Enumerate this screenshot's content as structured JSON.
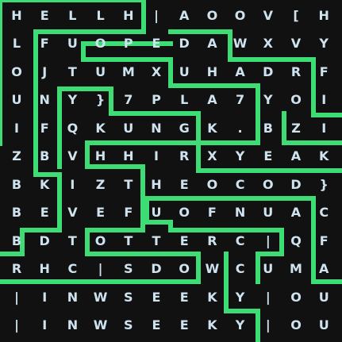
{
  "colors": {
    "background": "#111111",
    "letter": "#cfe3ef",
    "path": "#3ddc74"
  },
  "grid": {
    "rows": [
      [
        "H",
        "E",
        "L",
        "L",
        "H",
        "|",
        "A",
        "O",
        "O",
        "V",
        "[",
        "H"
      ],
      [
        "L",
        "F",
        "U",
        "O",
        "P",
        "E",
        "D",
        "A",
        "W",
        "X",
        "V",
        "Y"
      ],
      [
        "O",
        "J",
        "T",
        "U",
        "M",
        "X",
        "U",
        "H",
        "A",
        "D",
        "R",
        "F"
      ],
      [
        "U",
        "N",
        "Y",
        "}",
        "7",
        "P",
        "L",
        "A",
        "7",
        "Y",
        "O",
        "I"
      ],
      [
        "I",
        "F",
        "Q",
        "K",
        "U",
        "N",
        "G",
        "K",
        ".",
        "B",
        "Z",
        "I"
      ],
      [
        "Z",
        "B",
        "V",
        "H",
        "H",
        "I",
        "R",
        "X",
        "Y",
        "E",
        "A",
        "K"
      ],
      [
        "B",
        "K",
        "I",
        "Z",
        "T",
        "H",
        "E",
        "O",
        "C",
        "O",
        "D",
        "}"
      ],
      [
        "B",
        "E",
        "V",
        "E",
        "F",
        "U",
        "O",
        "F",
        "N",
        "U",
        "A",
        "C"
      ],
      [
        "B",
        "D",
        "T",
        "O",
        "T",
        "T",
        "E",
        "R",
        "C",
        "|",
        "Q",
        "F"
      ],
      [
        "R",
        "H",
        "C",
        "|",
        "S",
        "D",
        "O",
        "W",
        "C",
        "U",
        "M",
        "A"
      ],
      [
        "|",
        "I",
        "N",
        "W",
        "S",
        "E",
        "E",
        "K",
        "Y",
        "|",
        "O",
        "U"
      ],
      [
        "|",
        "I",
        "N",
        "W",
        "S",
        "E",
        "E",
        "K",
        "Y",
        "|",
        "O",
        "U"
      ]
    ]
  },
  "path": {
    "segments": [
      [
        [
          0,
          0
        ],
        [
          0,
          181
        ]
      ],
      [
        [
          0,
          181
        ],
        [
          -10,
          181
        ]
      ],
      [
        [
          0,
          0
        ],
        [
          181,
          0
        ]
      ],
      [
        [
          181,
          0
        ],
        [
          181,
          40
        ]
      ],
      [
        [
          181,
          40
        ],
        [
          45,
          40
        ]
      ],
      [
        [
          45,
          40
        ],
        [
          45,
          220
        ]
      ],
      [
        [
          45,
          220
        ],
        [
          75,
          220
        ]
      ],
      [
        [
          75,
          220
        ],
        [
          75,
          290
        ]
      ],
      [
        [
          75,
          290
        ],
        [
          28,
          290
        ]
      ],
      [
        [
          28,
          290
        ],
        [
          28,
          320
        ]
      ],
      [
        [
          28,
          320
        ],
        [
          -10,
          320
        ]
      ],
      [
        [
          105,
          55
        ],
        [
          105,
          75
        ]
      ],
      [
        [
          105,
          75
        ],
        [
          215,
          75
        ]
      ],
      [
        [
          215,
          75
        ],
        [
          215,
          108
        ]
      ],
      [
        [
          215,
          108
        ],
        [
          325,
          108
        ]
      ],
      [
        [
          325,
          108
        ],
        [
          325,
          180
        ]
      ],
      [
        [
          325,
          180
        ],
        [
          250,
          180
        ]
      ],
      [
        [
          250,
          180
        ],
        [
          250,
          143
        ]
      ],
      [
        [
          250,
          143
        ],
        [
          140,
          143
        ]
      ],
      [
        [
          140,
          143
        ],
        [
          140,
          112
        ]
      ],
      [
        [
          140,
          112
        ],
        [
          75,
          112
        ]
      ],
      [
        [
          75,
          112
        ],
        [
          75,
          180
        ]
      ],
      [
        [
          75,
          180
        ],
        [
          75,
          210
        ]
      ],
      [
        [
          105,
          55
        ],
        [
          215,
          55
        ]
      ],
      [
        [
          110,
          180
        ],
        [
          110,
          210
        ]
      ],
      [
        [
          110,
          180
        ],
        [
          250,
          180
        ]
      ],
      [
        [
          250,
          180
        ],
        [
          250,
          215
        ]
      ],
      [
        [
          250,
          215
        ],
        [
          431,
          215
        ]
      ],
      [
        [
          110,
          210
        ],
        [
          180,
          210
        ]
      ],
      [
        [
          180,
          210
        ],
        [
          180,
          290
        ]
      ],
      [
        [
          180,
          290
        ],
        [
          110,
          290
        ]
      ],
      [
        [
          110,
          290
        ],
        [
          110,
          320
        ]
      ],
      [
        [
          110,
          320
        ],
        [
          250,
          320
        ]
      ],
      [
        [
          250,
          320
        ],
        [
          250,
          355
        ]
      ],
      [
        [
          250,
          355
        ],
        [
          0,
          355
        ]
      ],
      [
        [
          215,
          40
        ],
        [
          290,
          40
        ]
      ],
      [
        [
          290,
          40
        ],
        [
          290,
          75
        ]
      ],
      [
        [
          290,
          75
        ],
        [
          395,
          75
        ]
      ],
      [
        [
          395,
          75
        ],
        [
          395,
          145
        ]
      ],
      [
        [
          395,
          145
        ],
        [
          431,
          145
        ]
      ],
      [
        [
          431,
          180
        ],
        [
          358,
          180
        ]
      ],
      [
        [
          358,
          180
        ],
        [
          358,
          143
        ]
      ],
      [
        [
          185,
          250
        ],
        [
          185,
          280
        ]
      ],
      [
        [
          185,
          250
        ],
        [
          395,
          250
        ]
      ],
      [
        [
          395,
          250
        ],
        [
          395,
          355
        ]
      ],
      [
        [
          395,
          355
        ],
        [
          431,
          355
        ]
      ],
      [
        [
          215,
          280
        ],
        [
          215,
          290
        ]
      ],
      [
        [
          185,
          280
        ],
        [
          215,
          280
        ]
      ],
      [
        [
          215,
          290
        ],
        [
          355,
          290
        ]
      ],
      [
        [
          355,
          290
        ],
        [
          355,
          320
        ]
      ],
      [
        [
          355,
          320
        ],
        [
          325,
          320
        ]
      ],
      [
        [
          325,
          320
        ],
        [
          325,
          355
        ]
      ],
      [
        [
          285,
          320
        ],
        [
          285,
          392
        ]
      ],
      [
        [
          285,
          392
        ],
        [
          325,
          392
        ]
      ],
      [
        [
          325,
          392
        ],
        [
          325,
          431
        ]
      ],
      [
        [
          250,
          355
        ],
        [
          250,
          355
        ]
      ]
    ]
  }
}
